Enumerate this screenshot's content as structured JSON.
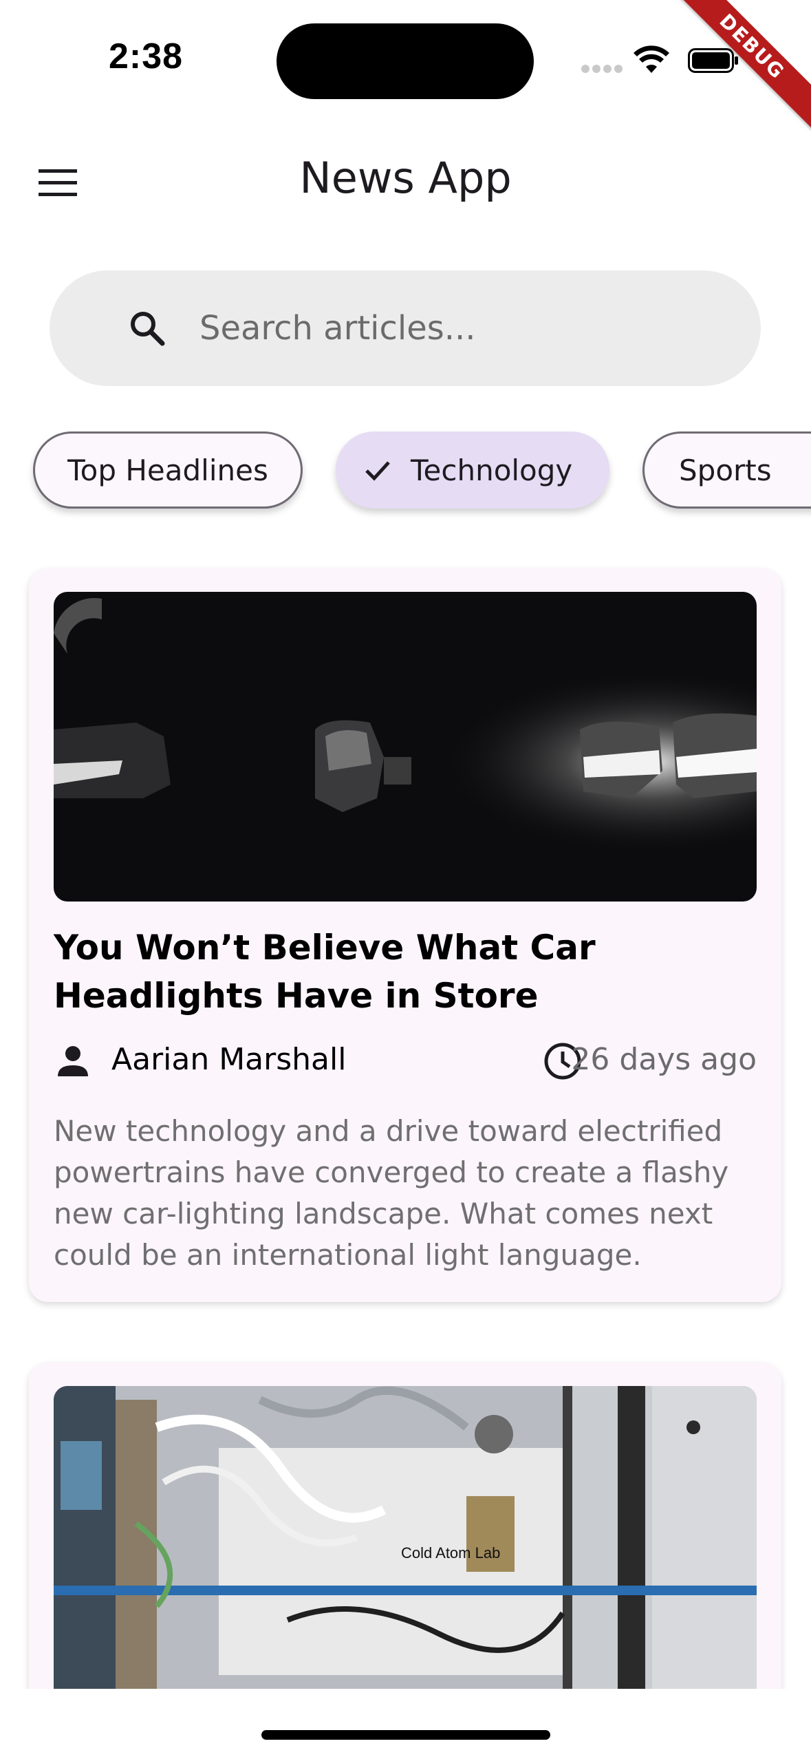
{
  "status_bar": {
    "time": "2:38",
    "debug_label": "DEBUG"
  },
  "app_bar": {
    "title": "News App",
    "menu_icon": "hamburger-menu-icon"
  },
  "search": {
    "placeholder": "Search articles...",
    "value": "",
    "icon": "search-icon"
  },
  "categories": [
    {
      "label": "Top Headlines",
      "selected": false
    },
    {
      "label": "Technology",
      "selected": true
    },
    {
      "label": "Sports",
      "selected": false
    }
  ],
  "articles": [
    {
      "title": "You Won’t Believe What Car Headlights Have in Store",
      "author": "Aarian Marshall",
      "time_ago": "26 days ago",
      "description": "New technology and a drive toward electrified powertrains have converged to create a flashy new car-lighting landscape. What comes next could be an international light language.",
      "image": "car-headlights-photo"
    },
    {
      "image": "cold-atom-lab-photo",
      "image_text": "Cold Atom Lab"
    }
  ],
  "colors": {
    "accent_chip": "#e6dcf4",
    "card_bg": "#fcf5fc",
    "debug_red": "#b71c1c"
  }
}
